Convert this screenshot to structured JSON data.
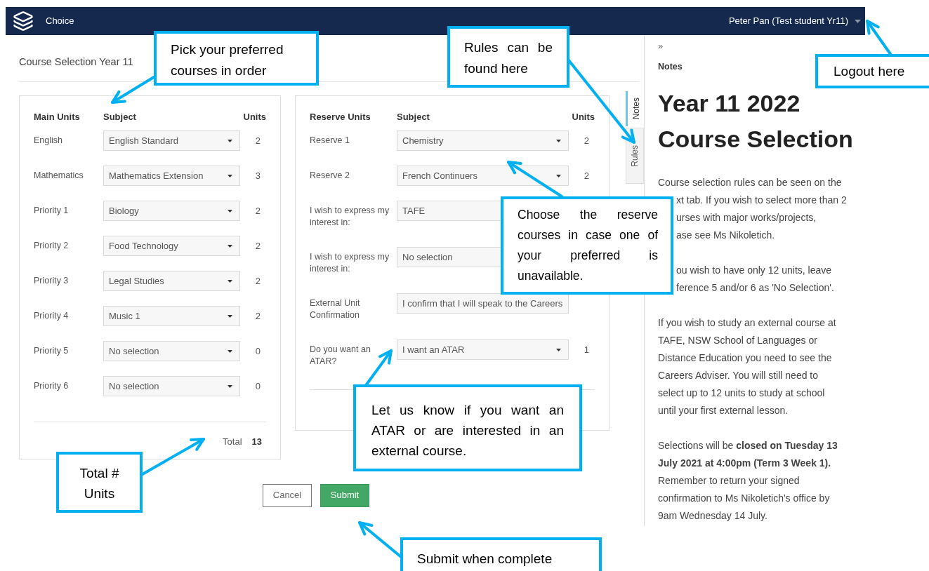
{
  "header": {
    "app_name": "Choice",
    "user": "Peter Pan (Test student Yr11)"
  },
  "page_title": "Course Selection Year 11",
  "main_units": {
    "columns": [
      "Main Units",
      "Subject",
      "Units"
    ],
    "rows": [
      {
        "label": [
          "English"
        ],
        "subject": "English Standard",
        "units": "2"
      },
      {
        "label": [
          "Mathematics"
        ],
        "subject": "Mathematics Extension",
        "units": "3"
      },
      {
        "label": [
          "Priority 1"
        ],
        "subject": "Biology",
        "units": "2"
      },
      {
        "label": [
          "Priority 2"
        ],
        "subject": "Food Technology",
        "units": "2"
      },
      {
        "label": [
          "Priority 3"
        ],
        "subject": "Legal Studies",
        "units": "2"
      },
      {
        "label": [
          "Priority 4"
        ],
        "subject": "Music 1",
        "units": "2"
      },
      {
        "label": [
          "Priority 5"
        ],
        "subject": "No selection",
        "units": "0"
      },
      {
        "label": [
          "Priority 6"
        ],
        "subject": "No selection",
        "units": "0"
      }
    ],
    "total_label": "Total",
    "total": "13"
  },
  "reserve_units": {
    "columns": [
      "Reserve Units",
      "Subject",
      "Units"
    ],
    "rows": [
      {
        "label": [
          "Reserve 1"
        ],
        "subject": "Chemistry",
        "units": "2"
      },
      {
        "label": [
          "Reserve 2"
        ],
        "subject": "French Continuers",
        "units": "2"
      },
      {
        "label": [
          "I wish to express my",
          "interest in:"
        ],
        "subject": "TAFE"
      },
      {
        "label": [
          "I wish to express my",
          "interest in:"
        ],
        "subject": "No selection"
      },
      {
        "label": [
          "External Unit",
          "Confirmation"
        ],
        "subject": "I confirm that I will speak to the Careers"
      },
      {
        "label": [
          "Do you want an",
          "ATAR?"
        ],
        "subject": "I want an ATAR",
        "units": "1"
      }
    ]
  },
  "buttons": [
    {
      "label": "Cancel",
      "kind": "secondary"
    },
    {
      "label": "Submit",
      "kind": "primary"
    }
  ],
  "side_tabs": [
    {
      "label": "Notes",
      "selected": true
    },
    {
      "label": "Rules",
      "selected": false
    }
  ],
  "notes": {
    "collapse": "»",
    "heading": "Notes",
    "title": "Year 11 2022 Course Selection",
    "paragraphs": [
      {
        "lines": [
          {
            "text": "Course selection rules can be seen on the",
            "kind": "whole"
          },
          {
            "text": "xt tab. If you wish to select more than 2",
            "kind": "cut"
          },
          {
            "text": "urses with major works/projects,",
            "kind": "cut"
          },
          {
            "text": "ase see Ms Nikoletich.",
            "kind": "cut"
          }
        ]
      },
      {
        "lines": [
          {
            "text": "ou wish to have only 12 units, leave",
            "kind": "cut"
          },
          {
            "text": "ference 5 and/or 6 as 'No Selection'.",
            "kind": "cut"
          }
        ]
      },
      {
        "lines": [
          {
            "text": "If you wish to study an external course at",
            "kind": "whole"
          },
          {
            "text": "TAFE, NSW School of Languages or",
            "kind": "whole"
          },
          {
            "text": "Distance Education you need to see the",
            "kind": "whole"
          },
          {
            "text": "Careers Adviser. You will still need to",
            "kind": "whole"
          },
          {
            "text": "select up to 12 units to study at school",
            "kind": "whole"
          },
          {
            "text": "until your first external lesson.",
            "kind": "whole"
          }
        ]
      },
      {
        "lines": [
          {
            "text": "Selections will be **closed on Tuesday 13**",
            "kind": "whole"
          },
          {
            "text": "**July 2021 at 4:00pm (Term 3 Week 1).**",
            "kind": "whole"
          },
          {
            "text": "Remember to return your signed",
            "kind": "whole"
          },
          {
            "text": "confirmation to Ms Nikoletich's office by",
            "kind": "whole"
          },
          {
            "text": "9am Wednesday 14 July.",
            "kind": "whole"
          }
        ]
      }
    ]
  },
  "callouts": [
    {
      "text": "Pick your preferred courses in order"
    },
    {
      "text": "Rules can be found here"
    },
    {
      "text": "Logout here"
    },
    {
      "text": "Choose the reserve courses in case one of your preferred is unavailable."
    },
    {
      "text": "Let us know if you want an ATAR or are interested in an external course."
    },
    {
      "text": "Total # Units"
    },
    {
      "text": "Submit when complete"
    }
  ]
}
